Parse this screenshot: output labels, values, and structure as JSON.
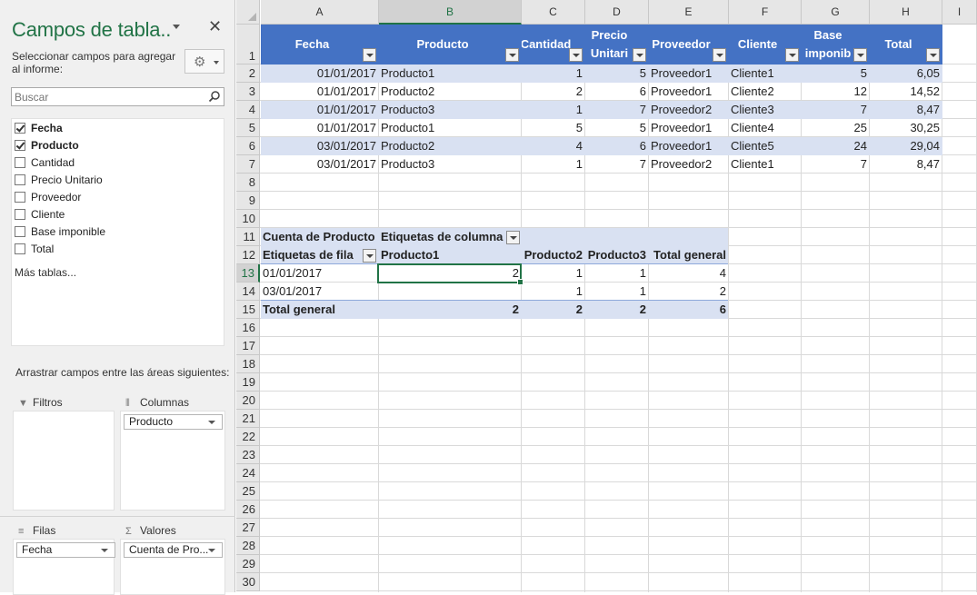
{
  "pane": {
    "title": "Campos de tabla..",
    "close": "✕",
    "instructions": "Seleccionar campos para agregar al informe:",
    "gear_icon": "gear-icon",
    "search_placeholder": "Buscar",
    "fields": [
      {
        "label": "Fecha",
        "checked": true
      },
      {
        "label": "Producto",
        "checked": true
      },
      {
        "label": "Cantidad",
        "checked": false
      },
      {
        "label": "Precio Unitario",
        "checked": false
      },
      {
        "label": "Proveedor",
        "checked": false
      },
      {
        "label": "Cliente",
        "checked": false
      },
      {
        "label": "Base imponible",
        "checked": false
      },
      {
        "label": "Total",
        "checked": false
      }
    ],
    "more_tables": "Más tablas...",
    "drag_instructions": "Arrastrar campos entre las áreas siguientes:",
    "areas": {
      "filters": {
        "label": "Filtros",
        "items": []
      },
      "columns": {
        "label": "Columnas",
        "items": [
          "Producto"
        ]
      },
      "rows": {
        "label": "Filas",
        "items": [
          "Fecha"
        ]
      },
      "values": {
        "label": "Valores",
        "items": [
          "Cuenta de Pro..."
        ]
      }
    }
  },
  "sheet": {
    "columns": [
      "A",
      "B",
      "C",
      "D",
      "E",
      "F",
      "G",
      "H",
      "I"
    ],
    "selected_column": "B",
    "selected_row": "13",
    "rows": [
      "1",
      "2",
      "3",
      "4",
      "5",
      "6",
      "7",
      "8",
      "9",
      "10",
      "11",
      "12",
      "13",
      "14",
      "15",
      "16",
      "17",
      "18",
      "19",
      "20",
      "21",
      "22",
      "23",
      "24",
      "25",
      "26",
      "27",
      "28",
      "29",
      "30"
    ],
    "table": {
      "headers": [
        "Fecha",
        "Producto",
        "Cantidad",
        "Precio Unitario",
        "Proveedor",
        "Cliente",
        "Base imponible",
        "Total"
      ],
      "header_display": [
        "Fecha",
        "Producto",
        "Cantidad",
        "Precio\nUnitari",
        "Proveedor",
        "Cliente",
        "Base\nimponib",
        "Total"
      ],
      "rows": [
        [
          "01/01/2017",
          "Producto1",
          "1",
          "5",
          "Proveedor1",
          "Cliente1",
          "5",
          "6,05"
        ],
        [
          "01/01/2017",
          "Producto2",
          "2",
          "6",
          "Proveedor1",
          "Cliente2",
          "12",
          "14,52"
        ],
        [
          "01/01/2017",
          "Producto3",
          "1",
          "7",
          "Proveedor2",
          "Cliente3",
          "7",
          "8,47"
        ],
        [
          "01/01/2017",
          "Producto1",
          "5",
          "5",
          "Proveedor1",
          "Cliente4",
          "25",
          "30,25"
        ],
        [
          "03/01/2017",
          "Producto2",
          "4",
          "6",
          "Proveedor1",
          "Cliente5",
          "24",
          "29,04"
        ],
        [
          "03/01/2017",
          "Producto3",
          "1",
          "7",
          "Proveedor2",
          "Cliente1",
          "7",
          "8,47"
        ]
      ],
      "header_color": "#4472c4",
      "band_color": "#d9e1f2"
    },
    "pivot": {
      "value_label": "Cuenta de Producto",
      "column_labels": "Etiquetas de columna",
      "row_labels": "Etiquetas de fila",
      "column_headers": [
        "Producto1",
        "Producto2",
        "Producto3",
        "Total general"
      ],
      "rows": [
        {
          "label": "01/01/2017",
          "values": [
            "2",
            "1",
            "1",
            "4"
          ]
        },
        {
          "label": "03/01/2017",
          "values": [
            "",
            "1",
            "1",
            "2"
          ]
        }
      ],
      "total": {
        "label": "Total general",
        "values": [
          "2",
          "2",
          "2",
          "6"
        ]
      }
    },
    "accent_color": "#217346"
  }
}
